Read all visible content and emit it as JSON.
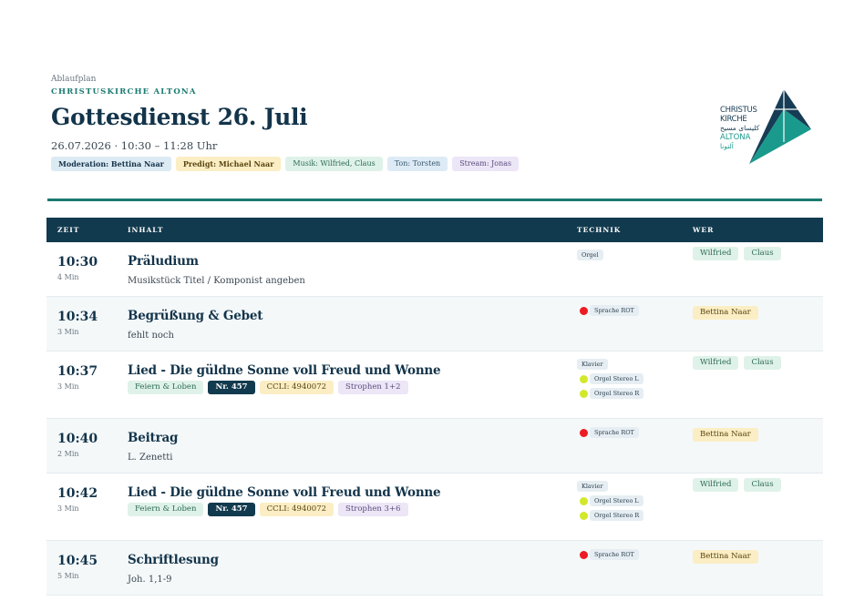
{
  "header": {
    "breadcrumb": "Ablaufplan",
    "organization": "CHRISTUSKIRCHE ALTONA",
    "title": "Gottesdienst 26. Juli",
    "meta": "26.07.2026 · 10:30 – 11:28 Uhr",
    "roles": [
      {
        "label": "Moderation: Bettina Naar",
        "color": "blue"
      },
      {
        "label": "Predigt: Michael Naar",
        "color": "yellow"
      },
      {
        "label": "Musik: Wilfried, Claus",
        "color": "green"
      },
      {
        "label": "Ton: Torsten",
        "color": "lblue"
      },
      {
        "label": "Stream: Jonas",
        "color": "purple"
      }
    ]
  },
  "logo": {
    "line1": "CHRISTUS",
    "line2": "KIRCHE",
    "line3": "كليساى مسيح",
    "line4": "ALTONA",
    "line5": "آلتونا",
    "colors": {
      "dark": "#173c55",
      "teal": "#1a9a8c"
    }
  },
  "table": {
    "headers": {
      "time": "ZEIT",
      "content": "INHALT",
      "tech": "TECHNIK",
      "who": "WER"
    },
    "rows": [
      {
        "time": "10:30",
        "duration": "4 Min",
        "title": "Präludium",
        "subtitle": "Musikstück Titel / Komponist angeben",
        "tags": [],
        "tech": [
          {
            "label": "Orgel",
            "dot": null
          }
        ],
        "who": [
          {
            "name": "Wilfried",
            "color": "green"
          },
          {
            "name": "Claus",
            "color": "green"
          }
        ]
      },
      {
        "time": "10:34",
        "duration": "3 Min",
        "title": "Begrüßung & Gebet",
        "subtitle": "fehlt noch",
        "tags": [],
        "tech": [
          {
            "label": "Sprache ROT",
            "dot": "red"
          }
        ],
        "who": [
          {
            "name": "Bettina Naar",
            "color": "yellow"
          }
        ]
      },
      {
        "time": "10:37",
        "duration": "3 Min",
        "title": "Lied - Die güldne Sonne voll Freud und Wonne",
        "subtitle": "",
        "tags": [
          {
            "label": "Feiern & Loben",
            "color": "green"
          },
          {
            "label": "Nr. 457",
            "color": "dark"
          },
          {
            "label": "CCLI: 4940072",
            "color": "yellow"
          },
          {
            "label": "Strophen 1+2",
            "color": "purple"
          }
        ],
        "tech": [
          {
            "label": "Klavier",
            "dot": null
          },
          {
            "label": "Orgel Stereo L",
            "dot": "lime"
          },
          {
            "label": "Orgel Stereo R",
            "dot": "lime"
          }
        ],
        "who": [
          {
            "name": "Wilfried",
            "color": "green"
          },
          {
            "name": "Claus",
            "color": "green"
          }
        ]
      },
      {
        "time": "10:40",
        "duration": "2 Min",
        "title": "Beitrag",
        "subtitle": "L. Zenetti",
        "tags": [],
        "tech": [
          {
            "label": "Sprache ROT",
            "dot": "red"
          }
        ],
        "who": [
          {
            "name": "Bettina Naar",
            "color": "yellow"
          }
        ]
      },
      {
        "time": "10:42",
        "duration": "3 Min",
        "title": "Lied - Die güldne Sonne voll Freud und Wonne",
        "subtitle": "",
        "tags": [
          {
            "label": "Feiern & Loben",
            "color": "green"
          },
          {
            "label": "Nr. 457",
            "color": "dark"
          },
          {
            "label": "CCLI: 4940072",
            "color": "yellow"
          },
          {
            "label": "Strophen 3+6",
            "color": "purple"
          }
        ],
        "tech": [
          {
            "label": "Klavier",
            "dot": null
          },
          {
            "label": "Orgel Stereo L",
            "dot": "lime"
          },
          {
            "label": "Orgel Stereo R",
            "dot": "lime"
          }
        ],
        "who": [
          {
            "name": "Wilfried",
            "color": "green"
          },
          {
            "name": "Claus",
            "color": "green"
          }
        ]
      },
      {
        "time": "10:45",
        "duration": "5 Min",
        "title": "Schriftlesung",
        "subtitle": "Joh. 1,1-9",
        "tags": [],
        "tech": [
          {
            "label": "Sprache ROT",
            "dot": "red"
          }
        ],
        "who": [
          {
            "name": "Bettina Naar",
            "color": "yellow"
          }
        ]
      }
    ]
  }
}
